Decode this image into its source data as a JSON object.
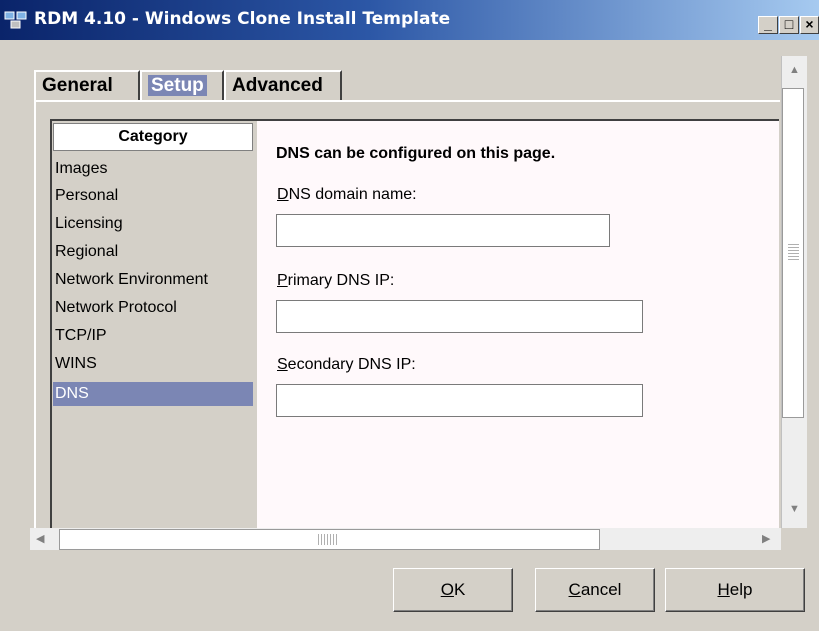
{
  "window": {
    "title": "RDM 4.10 - Windows Clone Install Template",
    "controls": {
      "minimize": "_",
      "maximize": "□",
      "close": "×"
    }
  },
  "tabs": [
    {
      "label": "General",
      "selected": false
    },
    {
      "label": "Setup",
      "selected": true
    },
    {
      "label": "Advanced",
      "selected": false
    }
  ],
  "category": {
    "header": "Category",
    "items": [
      "Images",
      "Personal",
      "Licensing",
      "Regional",
      "Network Environment",
      "Network Protocol",
      "TCP/IP",
      "WINS",
      "DNS"
    ],
    "selected": "DNS"
  },
  "dns": {
    "heading": "DNS can be configured on this page.",
    "domain_label_mnemonic": "D",
    "domain_label_rest": "NS domain name:",
    "domain_value": "",
    "primary_label_mnemonic": "P",
    "primary_label_rest": "rimary DNS IP:",
    "primary_value": "",
    "secondary_label_mnemonic": "S",
    "secondary_label_rest": "econdary DNS IP:",
    "secondary_value": ""
  },
  "buttons": {
    "ok_mnemonic": "O",
    "ok_rest": "K",
    "cancel_mnemonic": "C",
    "cancel_rest": "ancel",
    "help_mnemonic": "H",
    "help_rest": "elp"
  },
  "colors": {
    "selection": "#7b86b4",
    "title_bar": "#0a246a",
    "content_bg": "#fff9fb"
  }
}
